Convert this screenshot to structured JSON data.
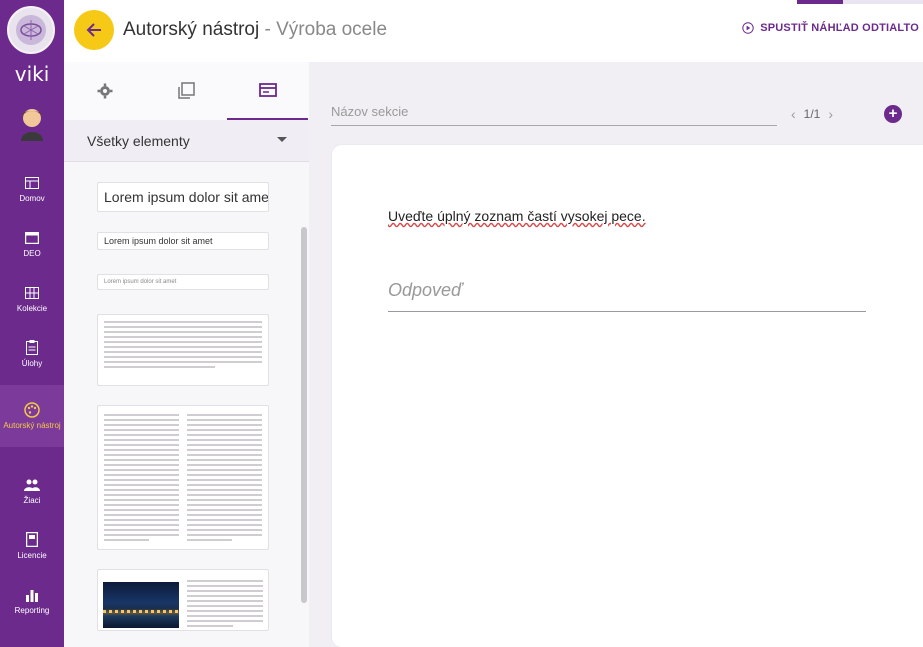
{
  "app": {
    "brand": "viki",
    "title": "Autorský nástroj",
    "separator": "-",
    "subtitle": "Výroba ocele",
    "preview_label": "SPUSTIŤ NÁHĽAD ODTIALTO",
    "accent_color": "#6b2a8c",
    "back_color": "#f6c916"
  },
  "nav": {
    "items": [
      {
        "label": "Domov",
        "icon": "dashboard-icon"
      },
      {
        "label": "DEO",
        "icon": "window-icon"
      },
      {
        "label": "Kolekcie",
        "icon": "grid-icon"
      },
      {
        "label": "Úlohy",
        "icon": "clipboard-icon"
      },
      {
        "label": "Autorský nástroj",
        "icon": "palette-icon",
        "active": true
      },
      {
        "label": "Žiaci",
        "icon": "students-icon"
      },
      {
        "label": "Licencie",
        "icon": "book-icon"
      },
      {
        "label": "Reporting",
        "icon": "bar-chart-icon"
      }
    ]
  },
  "panel": {
    "filter_label": "Všetky elementy",
    "elements": {
      "heading_large": "Lorem ipsum dolor sit amet",
      "heading_medium": "Lorem ipsum dolor sit amet",
      "heading_small": "Lorem ipsum dolor sit amet"
    }
  },
  "editor": {
    "section_placeholder": "Názov sekcie",
    "page_indicator": "1/1",
    "question": "Uveďte úplný zoznam častí vysokej pece.",
    "answer_placeholder": "Odpoveď"
  }
}
